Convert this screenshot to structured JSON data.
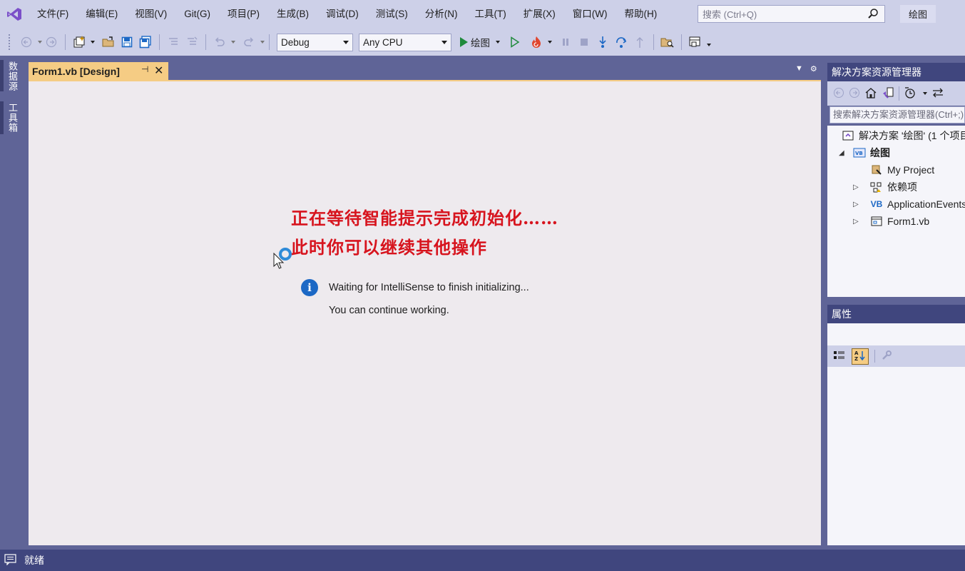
{
  "menu": {
    "items": [
      "文件(F)",
      "编辑(E)",
      "视图(V)",
      "Git(G)",
      "项目(P)",
      "生成(B)",
      "调试(D)",
      "测试(S)",
      "分析(N)",
      "工具(T)",
      "扩展(X)",
      "窗口(W)",
      "帮助(H)"
    ],
    "search_placeholder": "搜索 (Ctrl+Q)",
    "solution_name": "绘图"
  },
  "toolbar": {
    "configuration": "Debug",
    "platform": "Any CPU",
    "run_label": "绘图"
  },
  "left_strip": {
    "tabs": [
      "数据源",
      "工具箱"
    ]
  },
  "document": {
    "tab_title": "Form1.vb [Design]"
  },
  "overlay": {
    "line1": "正在等待智能提示完成初始化……",
    "line2": "此时你可以继续其他操作"
  },
  "info": {
    "line1": "Waiting for IntelliSense to finish initializing...",
    "line2": "You can continue working."
  },
  "solution_explorer": {
    "title": "解决方案资源管理器",
    "search_placeholder": "搜索解决方案资源管理器(Ctrl+;)",
    "tree": {
      "solution": "解决方案 '绘图' (1 个项目",
      "project": "绘图",
      "my_project": "My Project",
      "dependencies": "依赖项",
      "app_events": "ApplicationEvents.vb",
      "form1": "Form1.vb"
    }
  },
  "properties": {
    "title": "属性"
  },
  "status": {
    "text": "就绪"
  },
  "colors": {
    "accent": "#5f6497",
    "tab_active": "#f5cc84",
    "overlay_text": "#d7141e",
    "info_icon": "#1c68c5"
  }
}
